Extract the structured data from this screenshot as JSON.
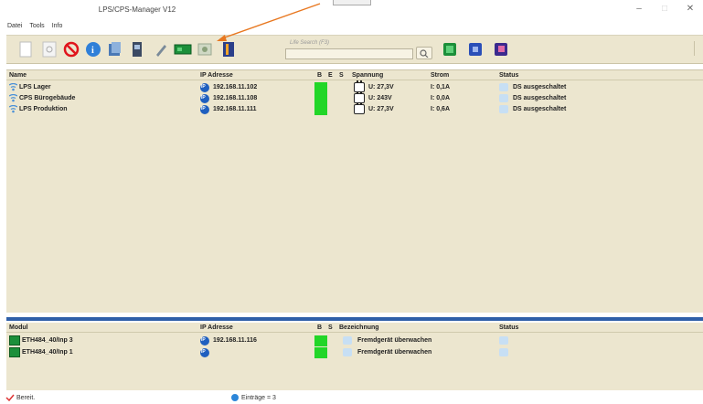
{
  "window": {
    "title": "LPS/CPS-Manager V12",
    "minimize_glyph": "–",
    "maximize_glyph": "□",
    "close_glyph": "✕"
  },
  "menu": [
    "Datei",
    "Tools",
    "Info"
  ],
  "toolbar": {
    "buttons": [
      {
        "name": "new-document-icon"
      },
      {
        "name": "find-icon"
      },
      {
        "name": "block-icon"
      },
      {
        "name": "info-icon"
      },
      {
        "name": "properties-icon"
      },
      {
        "name": "device-icon"
      },
      {
        "name": "edit-icon"
      },
      {
        "name": "module-icon"
      },
      {
        "name": "network-icon"
      },
      {
        "name": "book-icon"
      },
      {
        "name": "green-module-icon"
      },
      {
        "name": "blue-square-icon"
      },
      {
        "name": "purple-square-icon"
      }
    ],
    "search_label": "Life Search (F3)",
    "search_value": "",
    "colors": {
      "toolbar_bg": "#ece6cf",
      "led_green": "#22d628",
      "accent_blue": "#2f5fa8"
    }
  },
  "devices": {
    "headers": {
      "name": "Name",
      "ip": "IP Adresse",
      "b": "B",
      "e": "E",
      "s": "S",
      "spannung": "Spannung",
      "strom": "Strom",
      "status": "Status"
    },
    "rows": [
      {
        "name": "LPS Lager",
        "ip": "192.168.11.102",
        "spannung": "U: 27,3V",
        "strom": "I: 0,1A",
        "status": "DS ausgeschaltet"
      },
      {
        "name": "CPS Bürogebäude",
        "ip": "192.168.11.108",
        "spannung": "U: 243V",
        "strom": "I: 0,0A",
        "status": "DS ausgeschaltet"
      },
      {
        "name": "LPS Produktion",
        "ip": "192.168.11.111",
        "spannung": "U: 27,3V",
        "strom": "I: 0,6A",
        "status": "DS ausgeschaltet"
      }
    ]
  },
  "modules": {
    "headers": {
      "modul": "Modul",
      "ip": "IP Adresse",
      "b": "B",
      "s": "S",
      "bezeichnung": "Bezeichnung",
      "status": "Status"
    },
    "rows": [
      {
        "modul": "ETH484_40/Inp 3",
        "ip": "192.168.11.116",
        "bezeichnung": "Fremdgerät überwachen"
      },
      {
        "modul": "ETH484_40/Inp 1",
        "ip": "",
        "bezeichnung": "Fremdgerät überwachen"
      }
    ]
  },
  "statusbar": {
    "text": "Bereit.",
    "count": "Einträge = 3"
  }
}
